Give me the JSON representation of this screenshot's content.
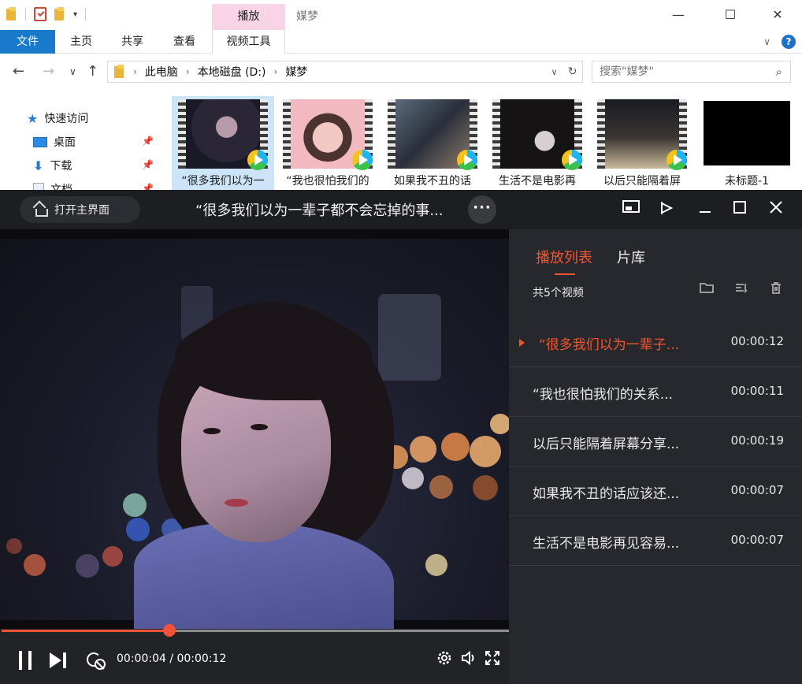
{
  "explorer": {
    "context_tab": "播放",
    "title": "媒梦",
    "ribbon_tabs": [
      "文件",
      "主页",
      "共享",
      "查看",
      "视频工具"
    ],
    "address": [
      "此电脑",
      "本地磁盘 (D:)",
      "媒梦"
    ],
    "search_placeholder": "搜索\"媒梦\"",
    "sidebar": [
      "快速访问",
      "桌面",
      "下载",
      "文档"
    ],
    "files": [
      "“很多我们以为一",
      "“我也很怕我们的",
      "如果我不丑的话",
      "生活不是电影再",
      "以后只能隔着屏",
      "未标题-1"
    ]
  },
  "player": {
    "home_label": "打开主界面",
    "title": "“很多我们以为一辈子都不会忘掉的事...",
    "current_time": "00:00:04",
    "total_time": "00:00:12",
    "time_display": "00:00:04 / 00:00:12",
    "progress": 0.33,
    "accent": "#f5552e",
    "panel": {
      "tabs": [
        "播放列表",
        "片库"
      ],
      "count": "共5个视频",
      "items": [
        {
          "title": "“很多我们以为一辈子...",
          "duration": "00:00:12"
        },
        {
          "title": "“我也很怕我们的关系...",
          "duration": "00:00:11"
        },
        {
          "title": "以后只能隔着屏幕分享...",
          "duration": "00:00:19"
        },
        {
          "title": "如果我不丑的话应该还...",
          "duration": "00:00:07"
        },
        {
          "title": "生活不是电影再见容易...",
          "duration": "00:00:07"
        }
      ]
    }
  }
}
